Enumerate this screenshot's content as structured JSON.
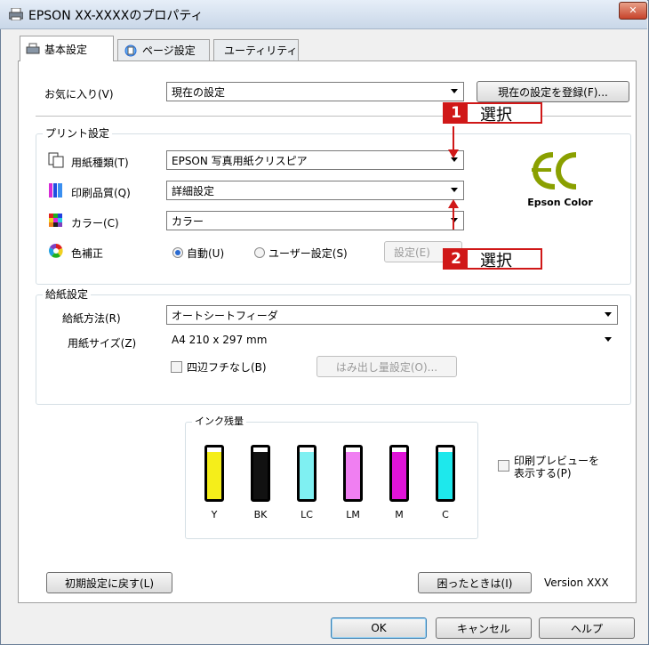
{
  "window": {
    "title": "EPSON XX-XXXXのプロパティ",
    "close_glyph": "✕"
  },
  "tabs": [
    {
      "label": "基本設定",
      "active": true
    },
    {
      "label": "ページ設定",
      "active": false
    },
    {
      "label": "ユーティリティ",
      "active": false
    }
  ],
  "favorites": {
    "label": "お気に入り(V)",
    "value": "現在の設定",
    "register_button": "現在の設定を登録(F)..."
  },
  "print_settings": {
    "group_label": "プリント設定",
    "paper_type": {
      "label": "用紙種類(T)",
      "value": "EPSON 写真用紙クリスピア"
    },
    "quality": {
      "label": "印刷品質(Q)",
      "value": "詳細設定"
    },
    "color": {
      "label": "カラー(C)",
      "value": "カラー"
    },
    "color_correction": {
      "label": "色補正",
      "auto_label": "自動(U)",
      "user_label": "ユーザー設定(S)",
      "settings_button": "設定(E)"
    }
  },
  "brand": {
    "symbol": "EC",
    "name": "Epson Color"
  },
  "callouts": [
    {
      "number": "1",
      "text": "選択"
    },
    {
      "number": "2",
      "text": "選択"
    }
  ],
  "paper_settings": {
    "group_label": "給紙設定",
    "source": {
      "label": "給紙方法(R)",
      "value": "オートシートフィーダ"
    },
    "size": {
      "label": "用紙サイズ(Z)",
      "value": "A4 210 x 297 mm"
    },
    "borderless_label": "四辺フチなし(B)",
    "expansion_button": "はみ出し量設定(O)..."
  },
  "ink": {
    "group_label": "インク残量",
    "cartridges": [
      {
        "name": "Y",
        "color": "#f5ee1a",
        "level": 0.92
      },
      {
        "name": "BK",
        "color": "#111111",
        "level": 0.92
      },
      {
        "name": "LC",
        "color": "#7ff0f2",
        "level": 0.92
      },
      {
        "name": "LM",
        "color": "#f07ff2",
        "level": 0.92
      },
      {
        "name": "M",
        "color": "#e014d8",
        "level": 0.92
      },
      {
        "name": "C",
        "color": "#1ee8ec",
        "level": 0.92
      }
    ]
  },
  "preview_label_1": "印刷プレビューを",
  "preview_label_2": "表示する(P)",
  "footer": {
    "reset_button": "初期設定に戻す(L)",
    "help_button": "困ったときは(I)",
    "version": "Version XXX"
  },
  "dialog_buttons": {
    "ok": "OK",
    "cancel": "キャンセル",
    "help": "ヘルプ"
  }
}
